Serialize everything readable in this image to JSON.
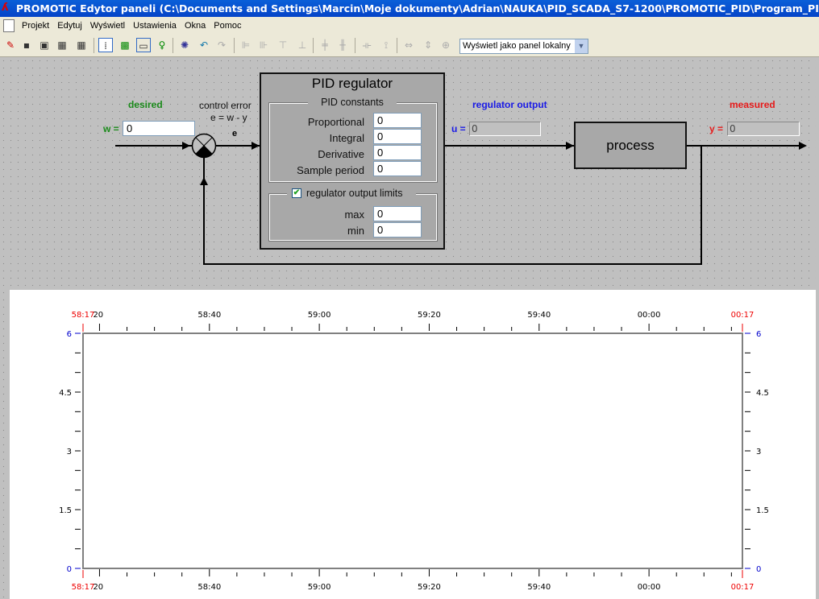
{
  "window": {
    "title": "PROMOTIC Edytor paneli (C:\\Documents and Settings\\Marcin\\Moje dokumenty\\Adrian\\NAUKA\\PID_SCADA_S7-1200\\PROMOTIC_PID\\Program_PID)  - [PmPanel: /PID"
  },
  "menu": [
    "Projekt",
    "Edytuj",
    "Wyświetl",
    "Ustawienia",
    "Okna",
    "Pomoc"
  ],
  "toolbar": {
    "view_mode": "Wyświetl jako panel lokalny"
  },
  "diagram": {
    "desired_label": "desired",
    "w_label": "w =",
    "w_value": "0",
    "control_error_label": "control  error",
    "error_formula": "e = w - y",
    "e_label": "e",
    "pid_title": "PID regulator",
    "pid_constants_label": "PID constants",
    "constants": [
      {
        "label": "Proportional",
        "value": "0"
      },
      {
        "label": "Integral",
        "value": "0"
      },
      {
        "label": "Derivative",
        "value": "0"
      },
      {
        "label": "Sample period",
        "value": "0"
      }
    ],
    "limits_label": "regulator output limits",
    "limits_checked": true,
    "limits": [
      {
        "label": "max",
        "value": "0"
      },
      {
        "label": "min",
        "value": "0"
      }
    ],
    "output_label": "regulator output",
    "u_label": "u =",
    "u_value": "0",
    "process_label": "process",
    "measured_label": "measured",
    "y_label": "y =",
    "y_value": "0",
    "colors": {
      "desired": "#1a8a1a",
      "output": "#1a1ae6",
      "measured": "#e61a1a"
    }
  },
  "chart_data": {
    "type": "line",
    "x_ticks": [
      {
        "label": "58:17",
        "edge": true
      },
      {
        "label": "20"
      },
      {
        "label": "58:40"
      },
      {
        "label": "59:00"
      },
      {
        "label": "59:20"
      },
      {
        "label": "59:40"
      },
      {
        "label": "00:00"
      },
      {
        "label": "00:17",
        "edge": true
      }
    ],
    "x_range": [
      "58:17",
      "00:17"
    ],
    "ylim": [
      0,
      6
    ],
    "y_ticks": [
      "0",
      "1.5",
      "3",
      "4.5",
      "6"
    ],
    "series": []
  }
}
